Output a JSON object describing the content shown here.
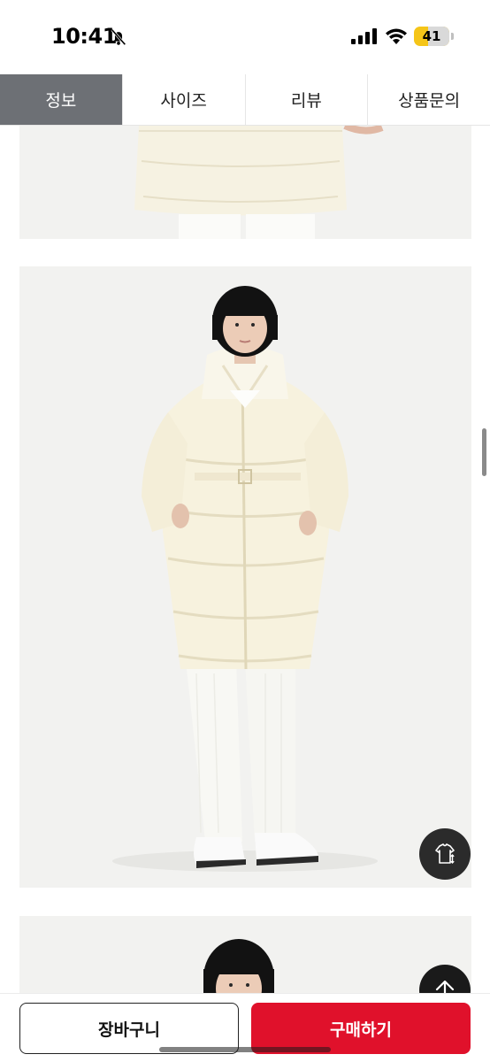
{
  "status_bar": {
    "time": "10:41",
    "battery_level": 41,
    "battery_label": "41",
    "battery_color": "#f5c518",
    "icons": [
      "bell-off-icon",
      "signal-icon",
      "wifi-icon",
      "battery-icon"
    ]
  },
  "tabs": [
    {
      "label": "정보",
      "active": true
    },
    {
      "label": "사이즈",
      "active": false
    },
    {
      "label": "리뷰",
      "active": false
    },
    {
      "label": "상품문의",
      "active": false
    }
  ],
  "colors": {
    "active_tab_bg": "#6d7075",
    "buy_button": "#e0112b",
    "photo_bg": "#f2f2f0"
  },
  "floating_buttons": {
    "size_guide_icon": "shirt-size-icon",
    "top_icon": "arrow-up-icon",
    "thumbnail_icon": "product-thumbnail"
  },
  "bottom_bar": {
    "cart_label": "장바구니",
    "buy_label": "구매하기"
  }
}
